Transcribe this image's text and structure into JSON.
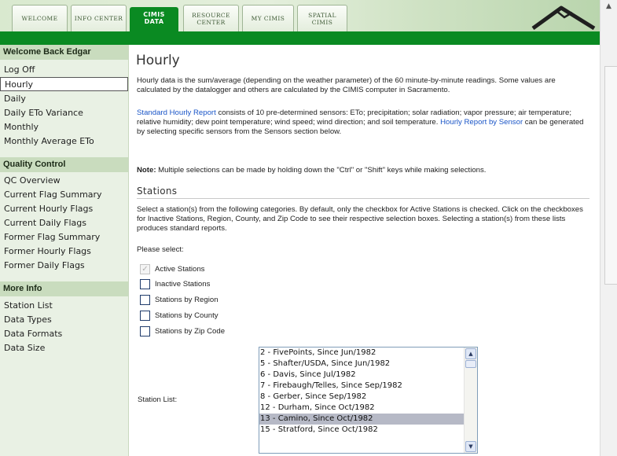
{
  "nav": {
    "tabs": [
      {
        "label": "Welcome"
      },
      {
        "label": "Info Center"
      },
      {
        "label": "CIMIS Data"
      },
      {
        "label": "Resource Center"
      },
      {
        "label": "My CIMIS"
      },
      {
        "label": "Spatial CIMIS"
      }
    ],
    "active_tab": "CIMIS Data",
    "logo_icon": "cimis-logo-icon"
  },
  "sidebar": {
    "sections": [
      {
        "heading": "Welcome Back Edgar",
        "items": [
          "Log Off",
          "Hourly",
          "Daily",
          "Daily ETo Variance",
          "Monthly",
          "Monthly Average ETo"
        ]
      },
      {
        "heading": "Quality Control",
        "items": [
          "QC Overview",
          "Current Flag Summary",
          "Current Hourly Flags",
          "Current Daily Flags",
          "Former Flag Summary",
          "Former Hourly Flags",
          "Former Daily Flags"
        ]
      },
      {
        "heading": "More Info",
        "items": [
          "Station List",
          "Data Types",
          "Data Formats",
          "Data Size"
        ]
      }
    ],
    "selected_item": "Hourly"
  },
  "main": {
    "title": "Hourly",
    "intro": "Hourly data is the sum/average (depending on the weather parameter) of the 60 minute-by-minute readings. Some values are calculated by the datalogger and others are calculated by the CIMIS computer in Sacramento.",
    "report_link": "Standard Hourly Report",
    "report_text": " consists of 10 pre-determined sensors: ETo; precipitation; solar radiation; vapor pressure; air temperature; relative humidity; dew point temperature; wind speed; wind direction; and soil temperature. ",
    "sensor_link": "Hourly Report by Sensor",
    "sensor_text": " can be generated by selecting specific sensors from the Sensors section below.",
    "note_bold": "Note:",
    "note_text": " Multiple selections can be made by holding down the \"Ctrl\" or \"Shift\" keys while making selections.",
    "stations_heading": "Stations",
    "stations_text": "Select a station(s) from the following categories. By default, only the checkbox for Active Stations is checked. Click on the checkboxes for Inactive Stations, Region, County, and Zip Code to see their respective selection boxes. Selecting a station(s) from these lists produces standard reports.",
    "please_select": "Please select:",
    "checkboxes": [
      {
        "label": "Active Stations",
        "checked": true
      },
      {
        "label": "Inactive Stations",
        "checked": false
      },
      {
        "label": "Stations by Region",
        "checked": false
      },
      {
        "label": "Stations by County",
        "checked": false
      },
      {
        "label": "Stations by Zip Code",
        "checked": false
      }
    ],
    "station_list_label": "Station List:",
    "station_list": [
      "2 - FivePoints, Since Jun/1982",
      "5 - Shafter/USDA, Since Jun/1982",
      "6 - Davis, Since Jul/1982",
      "7 - Firebaugh/Telles, Since Sep/1982",
      "8 - Gerber, Since Sep/1982",
      "12 - Durham, Since Oct/1982",
      "13 - Camino, Since Oct/1982",
      "15 - Stratford, Since Oct/1982"
    ],
    "selected_station": "13 - Camino, Since Oct/1982"
  },
  "colors": {
    "nav_green": "#0a8a22",
    "sidebar_bg": "#e9f1e4",
    "sidebar_heading_bg": "#c9dcbe",
    "link": "#1a55c7",
    "list_selection": "#b6b9c6"
  }
}
